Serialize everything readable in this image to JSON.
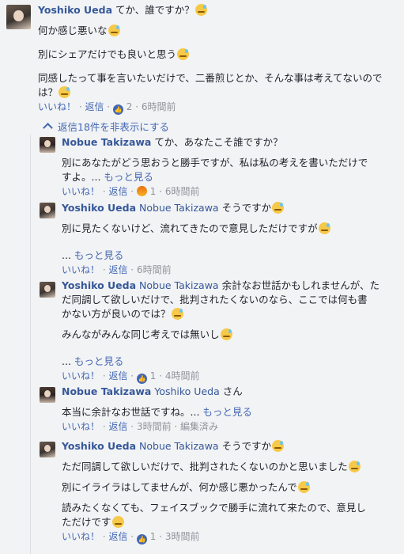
{
  "main": {
    "author": "Yoshiko Ueda",
    "lines": [
      "てか、誰ですか？",
      "何か感じ悪いな",
      "別にシェアだけでも良いと思う",
      "同感したって事を言いたいだけで、二番煎じとか、そんな事は考えてないので",
      "は？"
    ],
    "like": "いいね！",
    "reply": "返信",
    "like_count": "2",
    "time": "6時間前"
  },
  "toggle_label": "返信18件を非表示にする",
  "replies": [
    {
      "author": "Nobue Takizawa",
      "tag": "",
      "lines": [
        "てか、あなたこそ誰ですか？",
        "別にあなたがどう思おうと勝手ですが、私は私の考えを書いただけで",
        "すよ。"
      ],
      "more": "もっと見る",
      "like": "いいね！",
      "reply": "返信",
      "count": "1",
      "time": "6時間前"
    },
    {
      "author": "Yoshiko Ueda",
      "tag": "Nobue Takizawa",
      "lines": [
        "そうですか",
        "別に見たくないけど、流れてきたので意見しただけですが"
      ],
      "more": "もっと見る",
      "like": "いいね！",
      "reply": "返信",
      "time": "6時間前"
    },
    {
      "author": "Yoshiko Ueda",
      "tag": "Nobue Takizawa",
      "lines": [
        "余計なお世話かもしれませんが、た",
        "だ同調して欲しいだけで、批判されたくないのなら、ここでは何も書",
        "かない方が良いのでは？",
        "みんながみんな同じ考えでは無いし"
      ],
      "more": "もっと見る",
      "like": "いいね！",
      "reply": "返信",
      "count": "1",
      "time": "4時間前"
    },
    {
      "author": "Nobue Takizawa",
      "tag": "Yoshiko Ueda",
      "lines": [
        "さん",
        "本当に余計なお世話ですね。"
      ],
      "more": "もっと見る",
      "like": "いいね！",
      "reply": "返信",
      "time": "3時間前",
      "edited": "編集済み"
    },
    {
      "author": "Yoshiko Ueda",
      "tag": "Nobue Takizawa",
      "lines": [
        "そうですか",
        "ただ同調して欲しいだけで、批判されたくないのかと思いました",
        "別にイライラはしてませんが、何か感じ悪かったんで",
        "読みたくなくても、フェイスブックで勝手に流れて来たので、意見し",
        "ただけです"
      ],
      "like": "いいね！",
      "reply": "返信",
      "count": "1",
      "time": "3時間前"
    }
  ]
}
